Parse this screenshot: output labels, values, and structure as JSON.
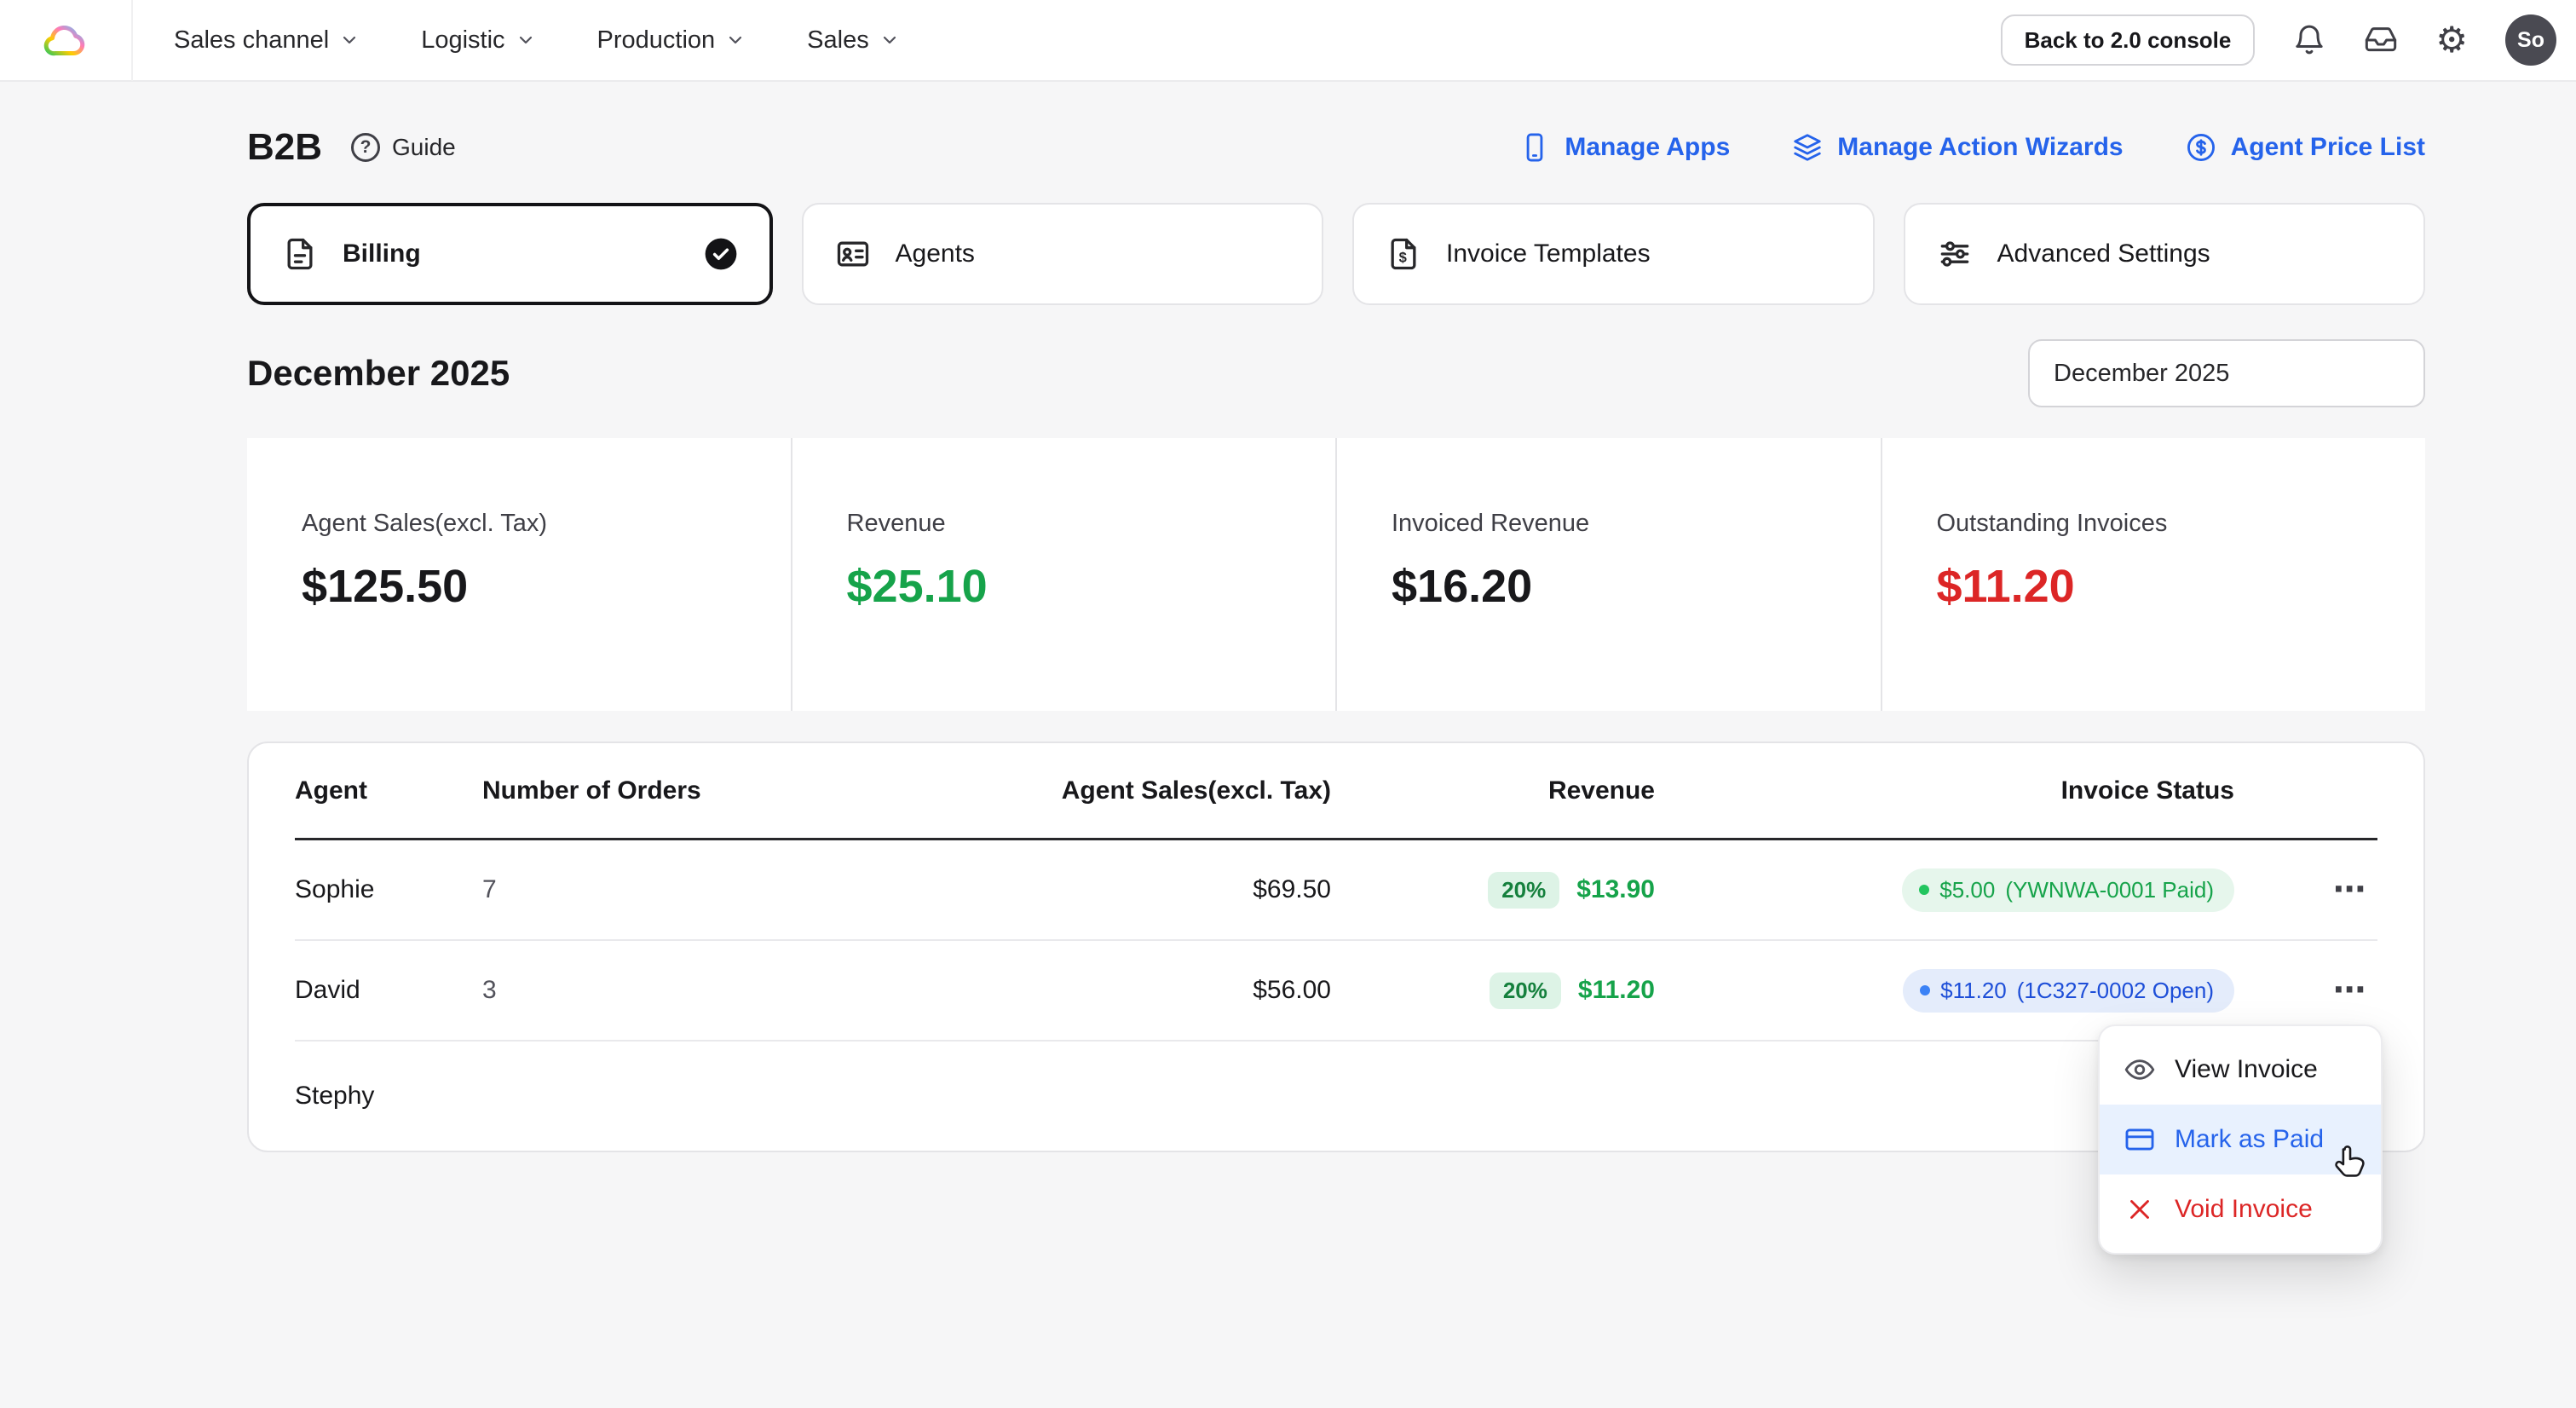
{
  "colors": {
    "accent_blue": "#2563eb",
    "positive_green": "#16a34a",
    "negative_red": "#dc2626",
    "paid_pill_bg": "#e6f6ec",
    "open_pill_bg": "#e4ecfb"
  },
  "navbar": {
    "menus": [
      {
        "label": "Sales channel"
      },
      {
        "label": "Logistic"
      },
      {
        "label": "Production"
      },
      {
        "label": "Sales"
      }
    ],
    "back_button_label": "Back to 2.0 console",
    "avatar_initials": "So"
  },
  "header": {
    "title": "B2B",
    "guide_label": "Guide",
    "links": [
      {
        "label": "Manage Apps"
      },
      {
        "label": "Manage Action Wizards"
      },
      {
        "label": "Agent Price List"
      }
    ]
  },
  "tabs": [
    {
      "label": "Billing",
      "selected": true
    },
    {
      "label": "Agents",
      "selected": false
    },
    {
      "label": "Invoice Templates",
      "selected": false
    },
    {
      "label": "Advanced Settings",
      "selected": false
    }
  ],
  "period": {
    "heading": "December 2025",
    "picker_value": "December 2025"
  },
  "stats": [
    {
      "label": "Agent Sales(excl. Tax)",
      "value": "$125.50"
    },
    {
      "label": "Revenue",
      "value": "$25.10"
    },
    {
      "label": "Invoiced Revenue",
      "value": "$16.20"
    },
    {
      "label": "Outstanding Invoices",
      "value": "$11.20"
    }
  ],
  "table": {
    "headers": [
      "Agent",
      "Number of Orders",
      "Agent Sales(excl. Tax)",
      "Revenue",
      "Invoice Status"
    ],
    "rows": [
      {
        "agent": "Sophie",
        "orders": "7",
        "sales": "$69.50",
        "revenue_pct": "20%",
        "revenue": "$13.90",
        "status_amount": "$5.00",
        "status_ref": "(YWNWA-0001 Paid)",
        "status_state": "paid"
      },
      {
        "agent": "David",
        "orders": "3",
        "sales": "$56.00",
        "revenue_pct": "20%",
        "revenue": "$11.20",
        "status_amount": "$11.20",
        "status_ref": "(1C327-0002 Open)",
        "status_state": "open"
      },
      {
        "agent": "Stephy",
        "orders": "",
        "sales": "",
        "revenue_pct": "",
        "revenue": ""
      }
    ]
  },
  "context_menu": {
    "items": [
      {
        "label": "View Invoice",
        "active": false
      },
      {
        "label": "Mark as Paid",
        "active": true
      },
      {
        "label": "Void Invoice",
        "danger": true
      }
    ]
  }
}
